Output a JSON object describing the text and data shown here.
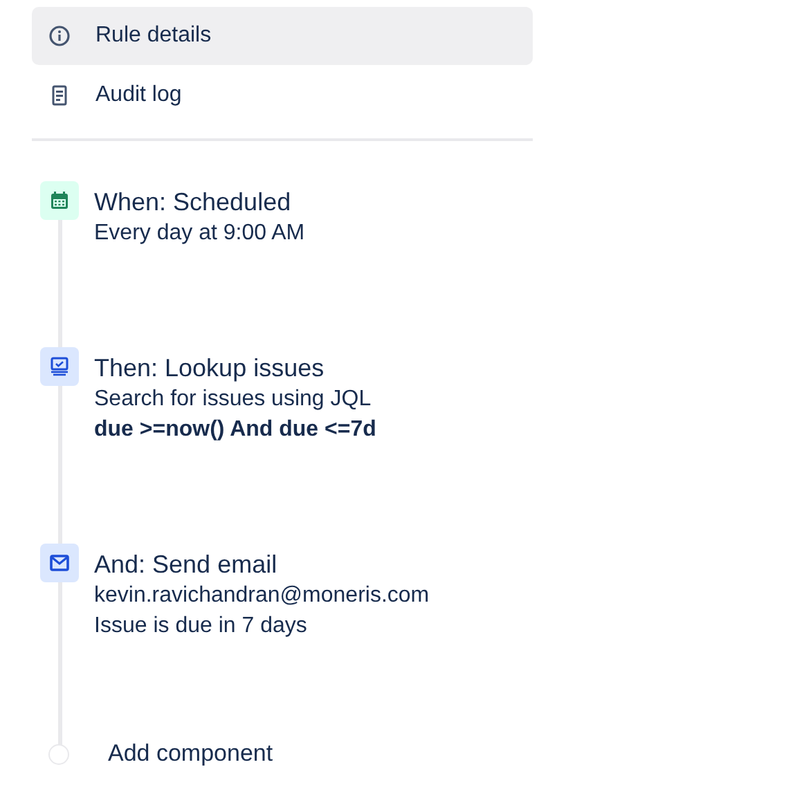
{
  "nav": [
    {
      "label": "Rule details",
      "selected": true
    },
    {
      "label": "Audit log",
      "selected": false
    }
  ],
  "steps": [
    {
      "kind": "trigger",
      "title": "When: Scheduled",
      "lines": [
        {
          "kind": "text",
          "text": "Every day at 9:00 AM"
        }
      ]
    },
    {
      "kind": "action",
      "title": "Then: Lookup issues",
      "lines": [
        {
          "kind": "text",
          "text": "Search for issues using JQL"
        },
        {
          "kind": "code",
          "text": "due >=now() And due <=7d"
        }
      ]
    },
    {
      "kind": "action",
      "title": "And: Send email",
      "lines": [
        {
          "kind": "text",
          "text": "kevin.ravichandran@moneris.com"
        },
        {
          "kind": "text",
          "text": "Issue is due in 7 days"
        }
      ]
    }
  ],
  "add": {
    "label": "Add component"
  }
}
